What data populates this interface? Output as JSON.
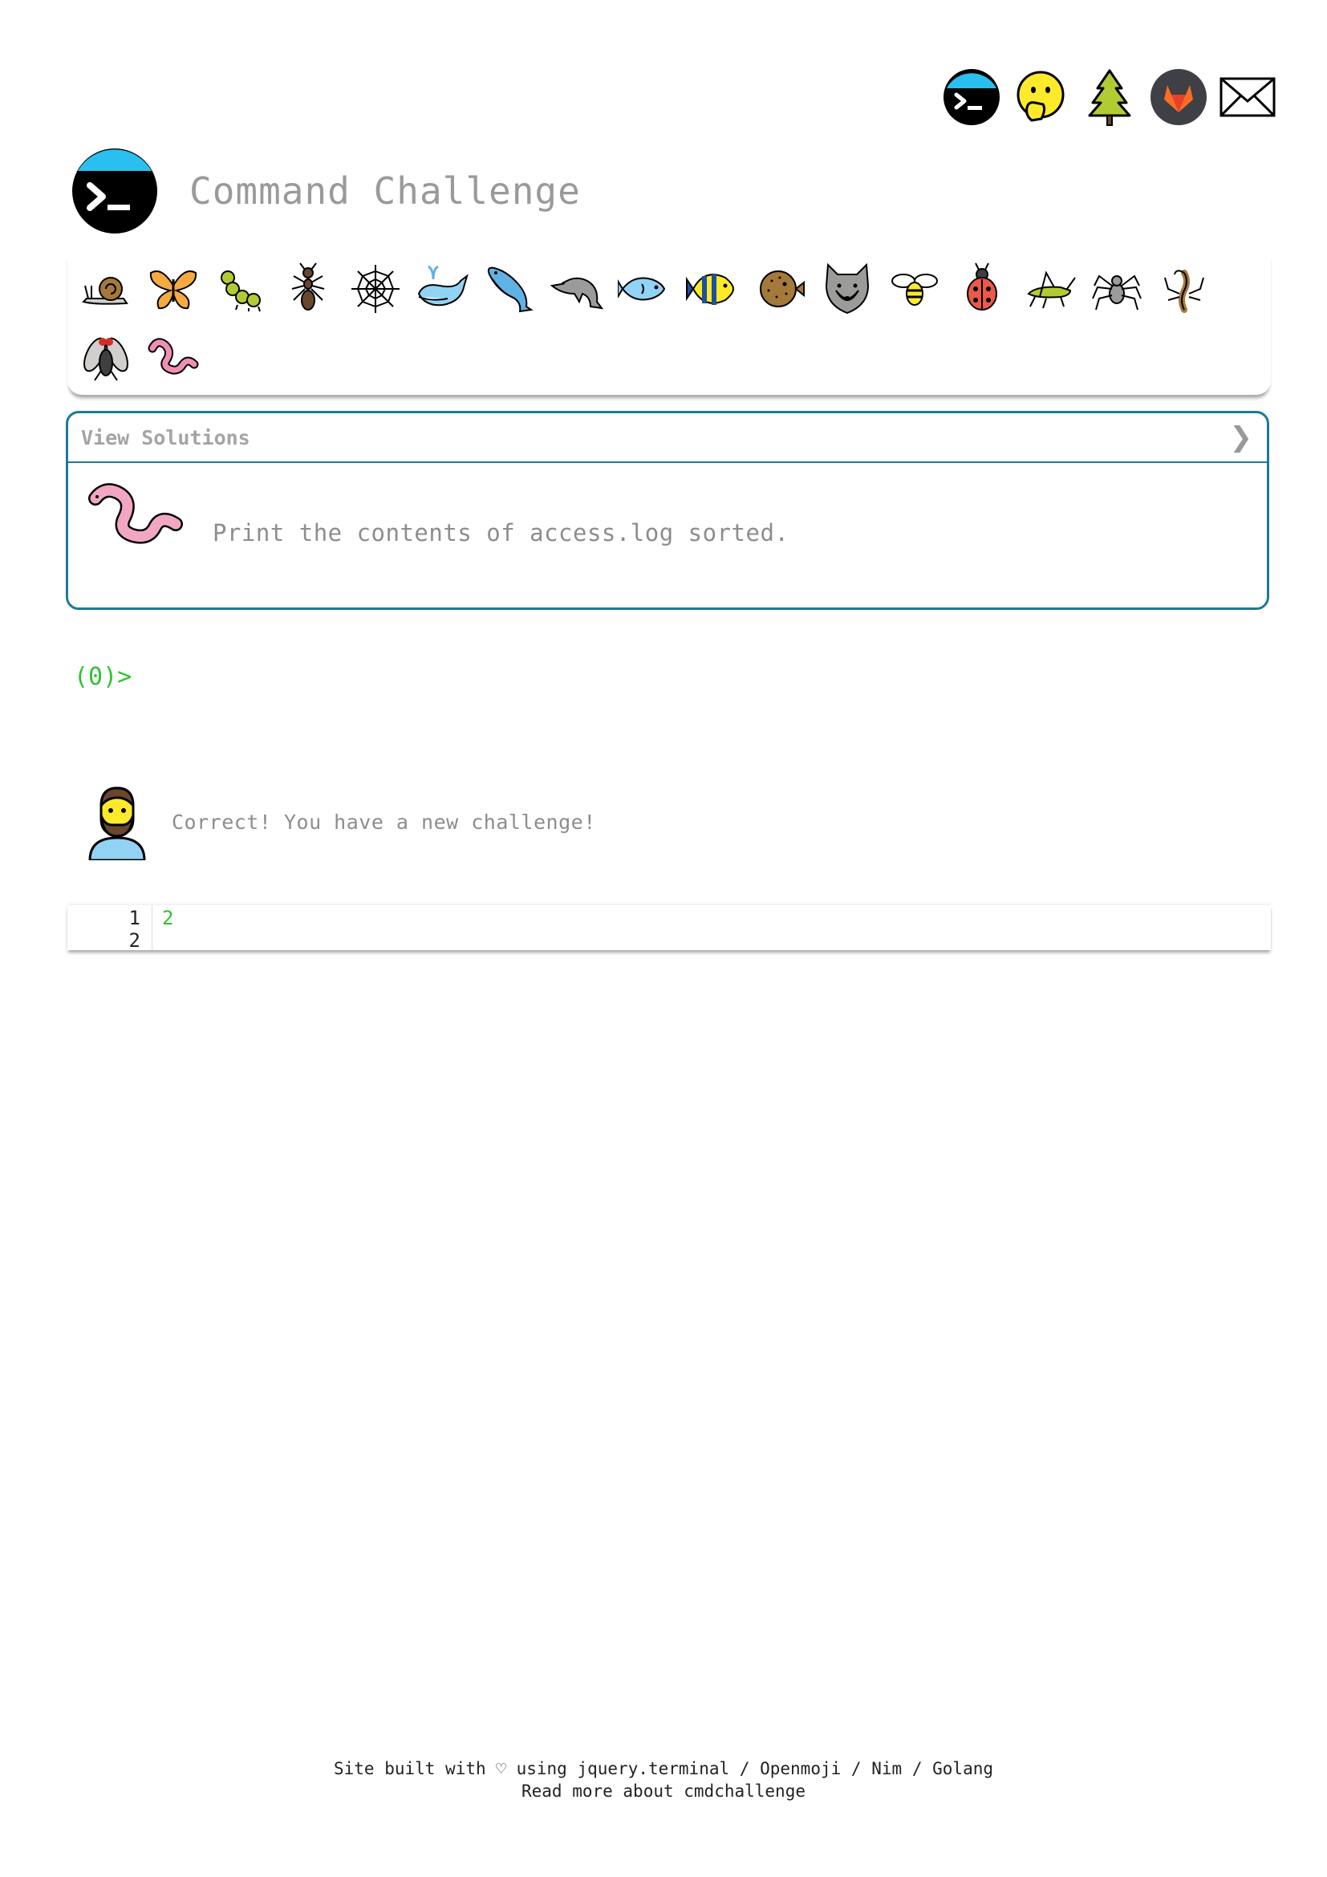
{
  "header": {
    "title": "Command Challenge"
  },
  "top_icons": [
    "terminal-icon",
    "face-with-hand-over-mouth-icon",
    "evergreen-tree-icon",
    "gitlab-icon",
    "envelope-icon"
  ],
  "badges": [
    "snail",
    "butterfly",
    "caterpillar",
    "ant",
    "spider-web",
    "spouting-whale",
    "whale",
    "dolphin",
    "fish",
    "tropical-fish",
    "blowfish",
    "wolf",
    "honeybee",
    "lady-beetle",
    "cricket",
    "spider",
    "scorpion",
    "fly",
    "worm"
  ],
  "panel": {
    "header_label": "View Solutions",
    "chevron": "❯",
    "question": "Print the contents of access.log sorted."
  },
  "prompt": {
    "text": "(0)>"
  },
  "result": {
    "message": "Correct! You have a new challenge!"
  },
  "editor": {
    "line_numbers": [
      "1",
      "2"
    ],
    "lines": [
      "2",
      ""
    ]
  },
  "footer": {
    "line1_prefix": "Site built with",
    "heart": "♡",
    "line1_using": "using",
    "links": [
      "jquery.terminal",
      "Openmoji",
      "Nim",
      "Golang"
    ],
    "separator": "/",
    "line2": "Read more about cmdchallenge"
  }
}
